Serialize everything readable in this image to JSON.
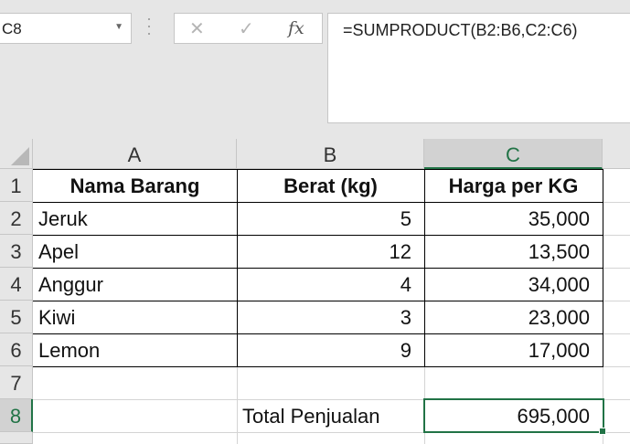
{
  "name_box": {
    "value": "C8",
    "dropdown_icon": "caret-down"
  },
  "formula_bar": {
    "cancel_icon": "cross",
    "enter_icon": "check",
    "function_icon": "fx",
    "function_label": "fx",
    "formula": "=SUMPRODUCT(B2:B6,C2:C6)"
  },
  "columns": [
    {
      "label": "A",
      "selected": false
    },
    {
      "label": "B",
      "selected": false
    },
    {
      "label": "C",
      "selected": true
    }
  ],
  "rows": [
    {
      "label": "1",
      "selected": false
    },
    {
      "label": "2",
      "selected": false
    },
    {
      "label": "3",
      "selected": false
    },
    {
      "label": "4",
      "selected": false
    },
    {
      "label": "5",
      "selected": false
    },
    {
      "label": "6",
      "selected": false
    },
    {
      "label": "7",
      "selected": false
    },
    {
      "label": "8",
      "selected": true
    }
  ],
  "table": {
    "headers": [
      "Nama Barang",
      "Berat (kg)",
      "Harga per KG"
    ],
    "data": [
      [
        "Jeruk",
        "5",
        "35,000"
      ],
      [
        "Apel",
        "12",
        "13,500"
      ],
      [
        "Anggur",
        "4",
        "34,000"
      ],
      [
        "Kiwi",
        "3",
        "23,000"
      ],
      [
        "Lemon",
        "9",
        "17,000"
      ]
    ]
  },
  "total": {
    "label": "Total Penjualan",
    "value": "695,000"
  },
  "accent_color": "#217346"
}
